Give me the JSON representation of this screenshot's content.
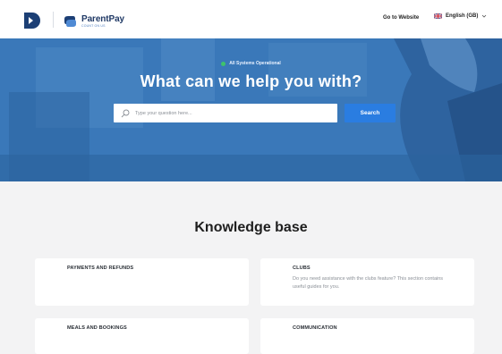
{
  "header": {
    "brand_name": "ParentPay",
    "brand_tagline": "COUNT ON US",
    "goto_label": "Go to Website",
    "language_label": "English (GB)",
    "icons": [
      "logo-mark-icon",
      "parentpay-logo-icon",
      "uk-flag-icon",
      "chevron-down-icon"
    ]
  },
  "hero": {
    "status_text": "All Systems Operational",
    "title": "What can we help you with?",
    "search_placeholder": "Type your question here...",
    "search_button_label": "Search",
    "colors": {
      "status": "#3fc36b",
      "button": "#2a7de1",
      "hero": "#3a78b9"
    }
  },
  "knowledge_base": {
    "title": "Knowledge base",
    "cards": [
      {
        "title": "PAYMENTS AND REFUNDS",
        "description": ""
      },
      {
        "title": "CLUBS",
        "description": "Do you need assistance with the clubs feature? This section contains useful guides for you."
      },
      {
        "title": "MEALS AND BOOKINGS",
        "description": ""
      },
      {
        "title": "COMMUNICATION",
        "description": ""
      }
    ]
  }
}
